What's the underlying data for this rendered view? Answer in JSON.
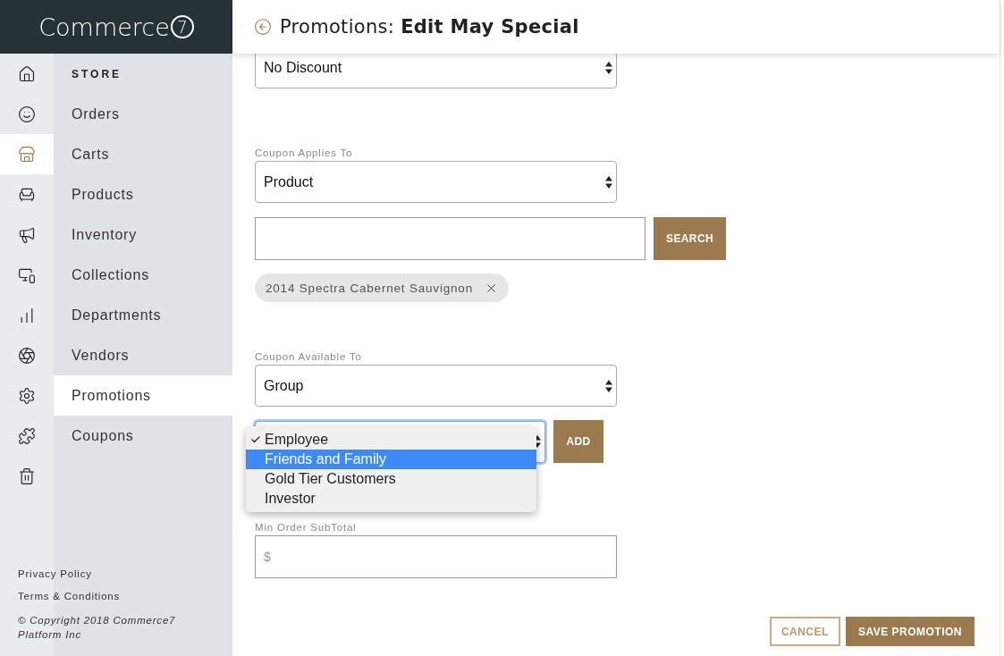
{
  "logo": {
    "text": "Commerce",
    "mark": "7"
  },
  "rail": [
    {
      "selected": false
    },
    {
      "selected": false
    },
    {
      "selected": true
    },
    {
      "selected": false
    },
    {
      "selected": false
    },
    {
      "selected": false
    },
    {
      "selected": false
    },
    {
      "selected": false
    },
    {
      "selected": false
    },
    {
      "selected": false
    },
    {
      "selected": false
    }
  ],
  "nav": {
    "heading": "STORE",
    "items": [
      {
        "label": "Orders",
        "selected": false
      },
      {
        "label": "Carts",
        "selected": false
      },
      {
        "label": "Products",
        "selected": false
      },
      {
        "label": "Inventory",
        "selected": false
      },
      {
        "label": "Collections",
        "selected": false
      },
      {
        "label": "Departments",
        "selected": false
      },
      {
        "label": "Vendors",
        "selected": false
      },
      {
        "label": "Promotions",
        "selected": true
      },
      {
        "label": "Coupons",
        "selected": false
      }
    ]
  },
  "footer": {
    "links": [
      "Privacy Policy",
      "Terms & Conditions"
    ],
    "copyright": "© Copyright 2018 Commerce7 Platform Inc"
  },
  "header": {
    "title": "Promotions: **Edit May Special**"
  },
  "discount_select": {
    "value": "No Discount"
  },
  "applies_to": {
    "label": "Coupon Applies To",
    "value": "Product",
    "search_button": "SEARCH",
    "chips": [
      "2014 Spectra Cabernet Sauvignon"
    ]
  },
  "available_to": {
    "label": "Coupon Available To",
    "value": "Group",
    "add_button": "ADD",
    "options": [
      {
        "label": "Employee",
        "checked": true,
        "highlighted": false
      },
      {
        "label": "Friends and Family",
        "checked": false,
        "highlighted": true
      },
      {
        "label": "Gold Tier Customers",
        "checked": false,
        "highlighted": false
      },
      {
        "label": "Investor",
        "checked": false,
        "highlighted": false
      }
    ]
  },
  "min_order": {
    "label": "Min Order SubTotal",
    "placeholder": "$"
  },
  "actions": {
    "cancel": "CANCEL",
    "save": "SAVE PROMOTION"
  }
}
